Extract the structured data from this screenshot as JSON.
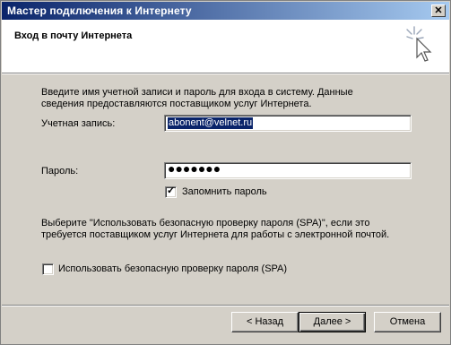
{
  "window": {
    "title": "Мастер подключения к Интернету"
  },
  "header": {
    "title": "Вход в почту Интернета",
    "icon": "wizard-magic-cursor-icon"
  },
  "intro": {
    "text": "Введите имя учетной записи и пароль для входа в систему. Данные сведения предоставляются поставщиком услуг Интернета."
  },
  "account": {
    "label": "Учетная запись:",
    "value": "abonent@velnet.ru"
  },
  "password": {
    "label": "Пароль:",
    "value": "●●●●●●●"
  },
  "remember": {
    "label": "Запомнить пароль",
    "checked": true
  },
  "spa_info": {
    "text": "Выберите \"Использовать безопасную проверку пароля (SPA)\", если это требуется поставщиком услуг Интернета для работы с электронной почтой."
  },
  "spa": {
    "label": "Использовать безопасную проверку пароля (SPA)",
    "checked": false
  },
  "buttons": {
    "back": "< Назад",
    "next": "Далее >",
    "cancel": "Отмена"
  },
  "close_glyph": "✕",
  "check_glyph": "✓",
  "colors": {
    "titlebar_start": "#0a246a",
    "titlebar_end": "#a6caf0",
    "face": "#d4d0c8",
    "selection": "#0a246a"
  }
}
